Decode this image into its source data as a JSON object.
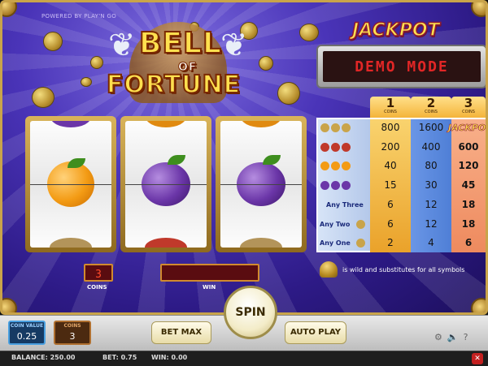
{
  "branding": {
    "powered_by": "POWERED BY PLAY'N GO",
    "logo_line1": "BELL",
    "logo_line2": "OF",
    "logo_line3": "FORTUNE"
  },
  "jackpot": {
    "title": "JACKPOT",
    "display": "DEMO MODE"
  },
  "paytable": {
    "columns": [
      {
        "number": "1",
        "label": "COINS"
      },
      {
        "number": "2",
        "label": "COINS"
      },
      {
        "number": "3",
        "label": "COINS"
      }
    ],
    "rows": [
      {
        "symbol": "three-bells-icon",
        "label": "",
        "values": [
          "800",
          "1600",
          "JACKPOT"
        ]
      },
      {
        "symbol": "three-strawberries-icon",
        "label": "",
        "values": [
          "200",
          "400",
          "600"
        ]
      },
      {
        "symbol": "three-oranges-icon",
        "label": "",
        "values": [
          "40",
          "80",
          "120"
        ]
      },
      {
        "symbol": "three-plums-icon",
        "label": "",
        "values": [
          "15",
          "30",
          "45"
        ]
      },
      {
        "symbol": "any-three-icon",
        "label": "Any Three",
        "values": [
          "6",
          "12",
          "18"
        ]
      },
      {
        "symbol": "any-two-bell-icon",
        "label": "Any Two",
        "values": [
          "6",
          "12",
          "18"
        ]
      },
      {
        "symbol": "any-one-bell-icon",
        "label": "Any One",
        "values": [
          "2",
          "4",
          "6"
        ]
      }
    ],
    "wild_note": "is wild and substitutes for all symbols"
  },
  "reels": [
    {
      "center": "orange-icon",
      "top": "plum-icon",
      "bottom": "bell-icon"
    },
    {
      "center": "plum-icon",
      "top": "orange-icon",
      "bottom": "strawberry-icon"
    },
    {
      "center": "plum-icon",
      "top": "orange-icon",
      "bottom": "bell-icon"
    }
  ],
  "readouts": {
    "coins_value": "3",
    "coins_label": "COINS",
    "win_value": "",
    "win_label": "WIN"
  },
  "controls": {
    "coin_value_label": "COIN VALUE",
    "coin_value": "0.25",
    "coins_label": "COINS",
    "coins": "3",
    "bet_max": "BET MAX",
    "spin": "SPIN",
    "auto_play": "AUTO PLAY"
  },
  "status": {
    "balance": "BALANCE: 250.00",
    "bet": "BET: 0.75",
    "win": "WIN: 0.00",
    "close": "✕"
  },
  "colors": {
    "background": "#2d1a86",
    "gold": "#c9a44a",
    "led_red": "#e12626",
    "paytable_col1": "#f4b43a",
    "paytable_col2": "#4f7fd6",
    "paytable_col3": "#f0936a"
  }
}
